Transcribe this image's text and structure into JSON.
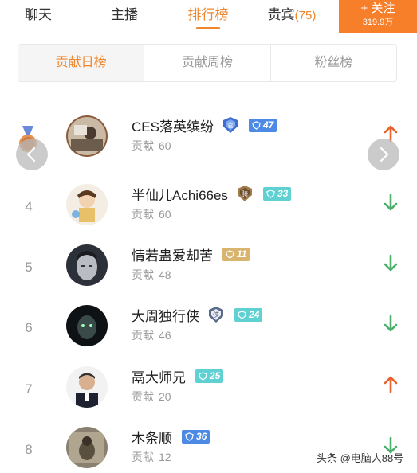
{
  "nav": {
    "tabs": [
      {
        "label": "聊天"
      },
      {
        "label": "主播"
      },
      {
        "label": "排行榜"
      },
      {
        "label": "贵宾",
        "count": "(75)"
      }
    ],
    "follow": {
      "label": "+ 关注",
      "count": "319.9万"
    }
  },
  "segments": [
    {
      "label": "贡献日榜",
      "active": true
    },
    {
      "label": "贡献周榜",
      "active": false
    },
    {
      "label": "粉丝榜",
      "active": false
    }
  ],
  "contrib_label": "贡献",
  "rows": [
    {
      "rank": "3",
      "name": "CES落英缤纷",
      "role": "官",
      "level": "47",
      "level_color": "blue",
      "contribution": "60",
      "trend": "up"
    },
    {
      "rank": "4",
      "name": "半仙儿Achi66es",
      "role": "骑",
      "level": "33",
      "level_color": "teal",
      "contribution": "60",
      "trend": "down"
    },
    {
      "rank": "5",
      "name": "情若蛊爱却苦",
      "role": "",
      "level": "11",
      "level_color": "gold",
      "contribution": "48",
      "trend": "down"
    },
    {
      "rank": "6",
      "name": "大周独行侠",
      "role": "侠",
      "level": "24",
      "level_color": "teal",
      "contribution": "46",
      "trend": "down"
    },
    {
      "rank": "7",
      "name": "鬲大师兄",
      "role": "",
      "level": "25",
      "level_color": "teal",
      "contribution": "20",
      "trend": "up"
    },
    {
      "rank": "8",
      "name": "木条顺",
      "role": "",
      "level": "36",
      "level_color": "blue",
      "contribution": "12",
      "trend": "down"
    }
  ],
  "colors": {
    "accent": "#f0862c",
    "up": "#e8622c",
    "down": "#4caf6a"
  },
  "watermark": "头条 @电脑人88号"
}
